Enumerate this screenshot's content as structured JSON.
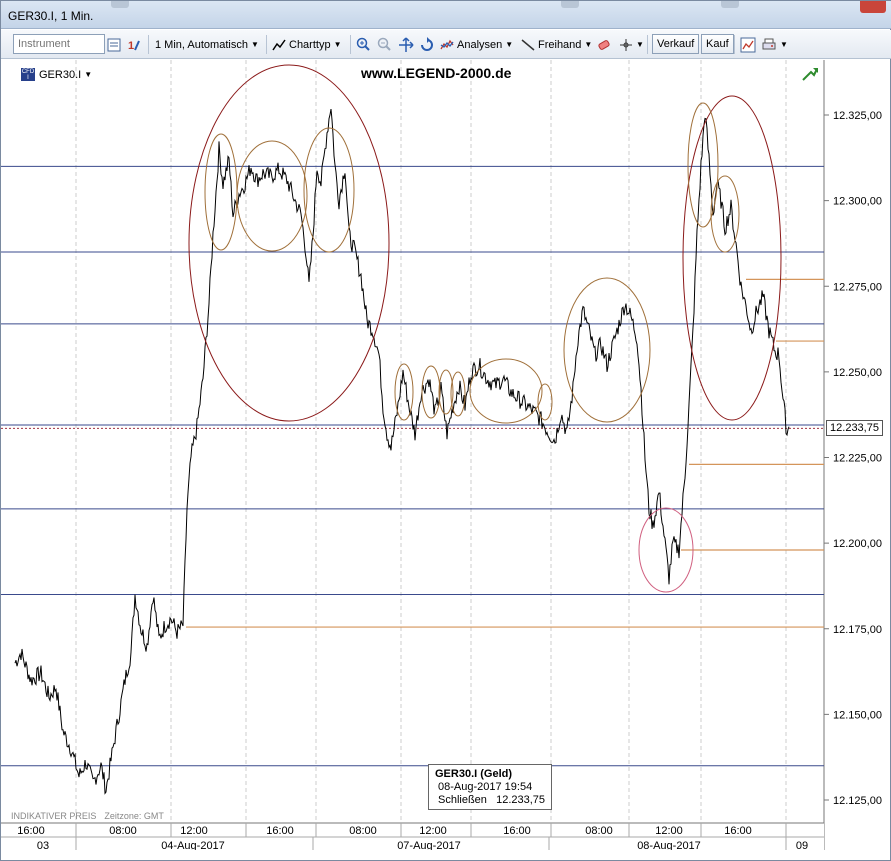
{
  "window": {
    "title": "GER30.I, 1 Min."
  },
  "toolbar": {
    "instrument_placeholder": "Instrument",
    "interval_label": "1 Min, Automatisch",
    "charttype_label": "Charttyp",
    "analysen_label": "Analysen",
    "freihand_label": "Freihand",
    "verkauf_label": "Verkauf",
    "kauf_label": "Kauf"
  },
  "chart": {
    "symbol": "GER30.I",
    "watermark": "www.LEGEND-2000.de",
    "footer_indicative": "INDIKATIVER PREIS",
    "footer_timezone": "Zeitzone: GMT",
    "current_price_label": "12.233,75",
    "y_ticks": [
      "12.325,00",
      "12.300,00",
      "12.275,00",
      "12.250,00",
      "12.225,00",
      "12.200,00",
      "12.175,00",
      "12.150,00",
      "12.125,00"
    ],
    "x_time_labels": [
      "16:00",
      "08:00",
      "12:00",
      "16:00",
      "08:00",
      "12:00",
      "16:00",
      "08:00",
      "12:00",
      "16:00"
    ],
    "x_date_labels": [
      "03",
      "04-Aug-2017",
      "07-Aug-2017",
      "08-Aug-2017",
      "09"
    ],
    "colors": {
      "line": "#000000",
      "hline_blue": "#3a4a8c",
      "hline_orange": "#d4955a",
      "circle_red": "#8b1a1a",
      "circle_brown": "#a0703a",
      "circle_pink": "#d06080"
    }
  },
  "tooltip": {
    "title": "GER30.I (Geld)",
    "datetime": "08-Aug-2017 19:54",
    "close_label": "Schließen",
    "close_value": "12.233,75"
  }
}
